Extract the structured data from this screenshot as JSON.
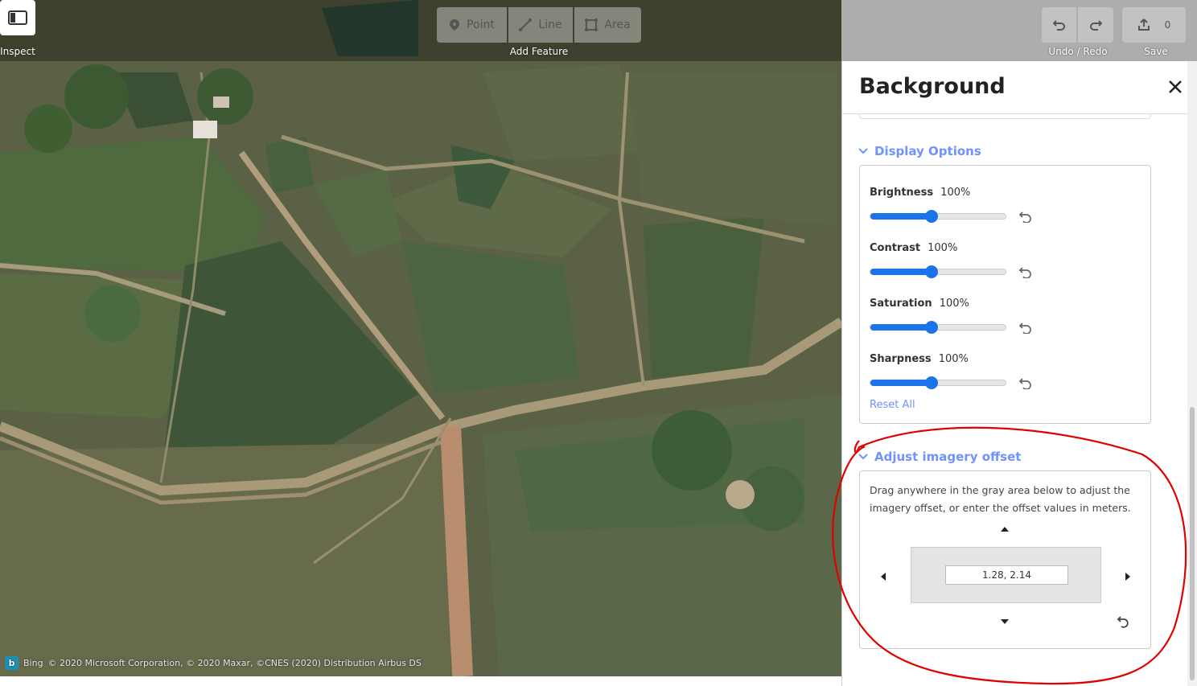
{
  "toolbar": {
    "inspect_label": "Inspect",
    "point_label": "Point",
    "line_label": "Line",
    "area_label": "Area",
    "add_feature_label": "Add Feature",
    "undo_redo_label": "Undo / Redo",
    "save_count": "0",
    "save_label": "Save"
  },
  "pane": {
    "title": "Background",
    "display_options": {
      "heading": "Display Options",
      "sliders": [
        {
          "label": "Brightness",
          "value_text": "100%",
          "value": 0.45
        },
        {
          "label": "Contrast",
          "value_text": "100%",
          "value": 0.45
        },
        {
          "label": "Saturation",
          "value_text": "100%",
          "value": 0.45
        },
        {
          "label": "Sharpness",
          "value_text": "100%",
          "value": 0.45
        }
      ],
      "reset_all": "Reset All"
    },
    "offset": {
      "heading": "Adjust imagery offset",
      "description": "Drag anywhere in the gray area below to adjust the imagery offset, or enter the offset values in meters.",
      "value": "1.28, 2.14"
    }
  },
  "map_controls": [
    "zoom-in-icon",
    "zoom-out-icon",
    "geolocate-icon",
    "background-layers-icon",
    "map-data-icon",
    "issues-icon",
    "preferences-icon",
    "help-icon"
  ],
  "attribution": {
    "provider": "Bing",
    "text": "© 2020 Microsoft Corporation, © 2020 Maxar, ©CNES (2020) Distribution Airbus DS"
  },
  "colors": {
    "accent": "#7092ff",
    "slider": "#1a73e8",
    "annotation": "#e00000"
  }
}
